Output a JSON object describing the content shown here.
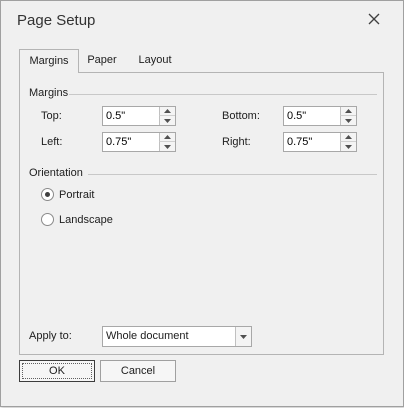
{
  "dialog": {
    "title": "Page Setup"
  },
  "tabs": [
    {
      "label": "Margins",
      "active": true
    },
    {
      "label": "Paper",
      "active": false
    },
    {
      "label": "Layout",
      "active": false
    }
  ],
  "margins": {
    "group_label": "Margins",
    "top_label": "Top:",
    "top_value": "0.5\"",
    "bottom_label": "Bottom:",
    "bottom_value": "0.5\"",
    "left_label": "Left:",
    "left_value": "0.75\"",
    "right_label": "Right:",
    "right_value": "0.75\""
  },
  "orientation": {
    "group_label": "Orientation",
    "portrait_label": "Portrait",
    "landscape_label": "Landscape",
    "selected": "Portrait"
  },
  "apply_to": {
    "label": "Apply to:",
    "value": "Whole document"
  },
  "buttons": {
    "ok": "OK",
    "cancel": "Cancel"
  }
}
